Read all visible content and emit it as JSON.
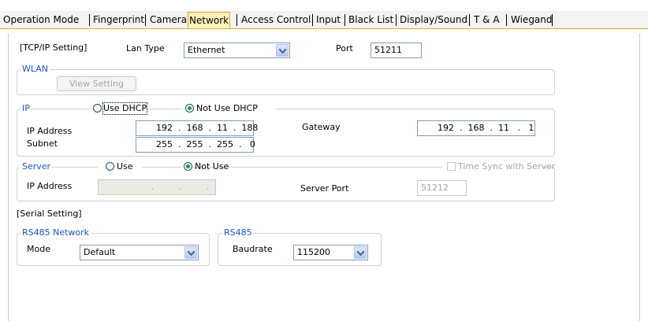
{
  "tabs": [
    {
      "label": "Operation Mode"
    },
    {
      "label": "Fingerprint"
    },
    {
      "label": "Camera"
    },
    {
      "label": "Network"
    },
    {
      "label": "Access Control"
    },
    {
      "label": "Input"
    },
    {
      "label": "Black List"
    },
    {
      "label": "Display/Sound"
    },
    {
      "label": "T & A"
    },
    {
      "label": "Wiegand"
    }
  ],
  "active_tab": "Network",
  "tcpip": {
    "section_label": "[TCP/IP Setting]",
    "lan_type_label": "Lan Type",
    "lan_type_value": "Ethernet",
    "port_label": "Port",
    "port_value": "51211"
  },
  "wlan": {
    "legend": "WLAN",
    "view_setting_label": "View Setting"
  },
  "ip": {
    "legend": "IP",
    "use_dhcp_label": "Use DHCP",
    "not_use_dhcp_label": "Not Use DHCP",
    "selected": "Not Use DHCP",
    "ip_address_label": "IP Address",
    "ip_address_value": "192  .  168  .  11  .  188",
    "subnet_label": "Subnet",
    "subnet_value": "255  .  255  .  255  .   0",
    "gateway_label": "Gateway",
    "gateway_value": "192  .  168  .  11   .   1"
  },
  "server": {
    "legend": "Server",
    "use_label": "Use",
    "not_use_label": "Not Use",
    "selected": "Not Use",
    "time_sync_label": "Time Sync with Server",
    "ip_address_label": "IP Address",
    "ip_address_value": "                  .         .         .",
    "server_port_label": "Server Port",
    "server_port_value": "51212"
  },
  "serial": {
    "section_label": "[Serial Setting]",
    "rs485_network_legend": "RS485 Network",
    "mode_label": "Mode",
    "mode_value": "Default",
    "rs485_legend": "RS485",
    "baudrate_label": "Baudrate",
    "baudrate_value": "115200"
  },
  "colors": {
    "accent_orange": "#f4a524",
    "legend_blue": "#1a53c9",
    "radio_green": "#21a121"
  }
}
